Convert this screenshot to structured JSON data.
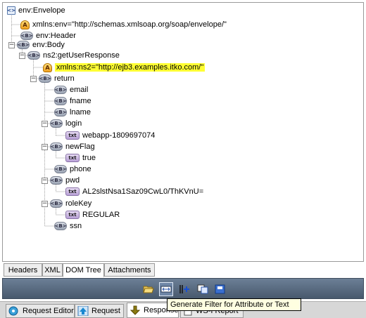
{
  "tree": [
    {
      "id": "n0",
      "type": "root",
      "label": "env:Envelope",
      "expander": "",
      "selected": false
    },
    {
      "id": "n1",
      "type": "attr",
      "label": "xmlns:env=\"http://schemas.xmlsoap.org/soap/envelope/\"",
      "expander": "",
      "selected": false
    },
    {
      "id": "n2",
      "type": "el",
      "label": "env:Header",
      "expander": "",
      "selected": false
    },
    {
      "id": "n3",
      "type": "el",
      "label": "env:Body",
      "expander": "−",
      "selected": false
    },
    {
      "id": "n4",
      "type": "el",
      "label": "ns2:getUserResponse",
      "expander": "−",
      "selected": false
    },
    {
      "id": "n5",
      "type": "attr",
      "label": "xmlns:ns2=\"http://ejb3.examples.itko.com/\"",
      "expander": "",
      "selected": true
    },
    {
      "id": "n6",
      "type": "el",
      "label": "return",
      "expander": "−",
      "selected": false
    },
    {
      "id": "n7",
      "type": "el",
      "label": "email",
      "expander": "",
      "selected": false
    },
    {
      "id": "n8",
      "type": "el",
      "label": "fname",
      "expander": "",
      "selected": false
    },
    {
      "id": "n9",
      "type": "el",
      "label": "lname",
      "expander": "",
      "selected": false
    },
    {
      "id": "n10",
      "type": "el",
      "label": "login",
      "expander": "−",
      "selected": false
    },
    {
      "id": "n11",
      "type": "txt",
      "label": "webapp-1809697074",
      "expander": "",
      "selected": false
    },
    {
      "id": "n12",
      "type": "el",
      "label": "newFlag",
      "expander": "−",
      "selected": false
    },
    {
      "id": "n13",
      "type": "txt",
      "label": "true",
      "expander": "",
      "selected": false
    },
    {
      "id": "n14",
      "type": "el",
      "label": "phone",
      "expander": "",
      "selected": false
    },
    {
      "id": "n15",
      "type": "el",
      "label": "pwd",
      "expander": "−",
      "selected": false
    },
    {
      "id": "n16",
      "type": "txt",
      "label": "AL2slstNsa1Saz09CwL0/ThKVnU=",
      "expander": "",
      "selected": false
    },
    {
      "id": "n17",
      "type": "el",
      "label": "roleKey",
      "expander": "−",
      "selected": false
    },
    {
      "id": "n18",
      "type": "txt",
      "label": "REGULAR",
      "expander": "",
      "selected": false
    },
    {
      "id": "n19",
      "type": "el",
      "label": "ssn",
      "expander": "",
      "selected": false
    }
  ],
  "badges": {
    "el": "<B>",
    "txt": "txt",
    "attr": "A",
    "root": "<>"
  },
  "view_tabs": [
    {
      "label": "Headers",
      "active": false
    },
    {
      "label": "XML",
      "active": false
    },
    {
      "label": "DOM Tree",
      "active": true
    },
    {
      "label": "Attachments",
      "active": false
    }
  ],
  "toolbar": {
    "buttons": [
      {
        "name": "open-folder-icon",
        "active": false
      },
      {
        "name": "generate-filter-icon",
        "active": true
      },
      {
        "name": "add-assertion-icon",
        "active": false
      },
      {
        "name": "copy-icon",
        "active": false
      },
      {
        "name": "save-icon",
        "active": false
      }
    ]
  },
  "tooltip": "Generate Filter for Attribute or Text",
  "request_tabs": [
    {
      "label": "Request Editor",
      "icon": "request-editor-icon",
      "active": false
    },
    {
      "label": "Request",
      "icon": "up-arrow-icon",
      "active": false
    },
    {
      "label": "Response",
      "icon": "down-arrow-icon",
      "active": true
    },
    {
      "label": "WS-I Report",
      "icon": "report-icon",
      "active": false
    }
  ],
  "colors": {
    "selection": "#ffff33",
    "toolbar": "#5a6c82"
  }
}
